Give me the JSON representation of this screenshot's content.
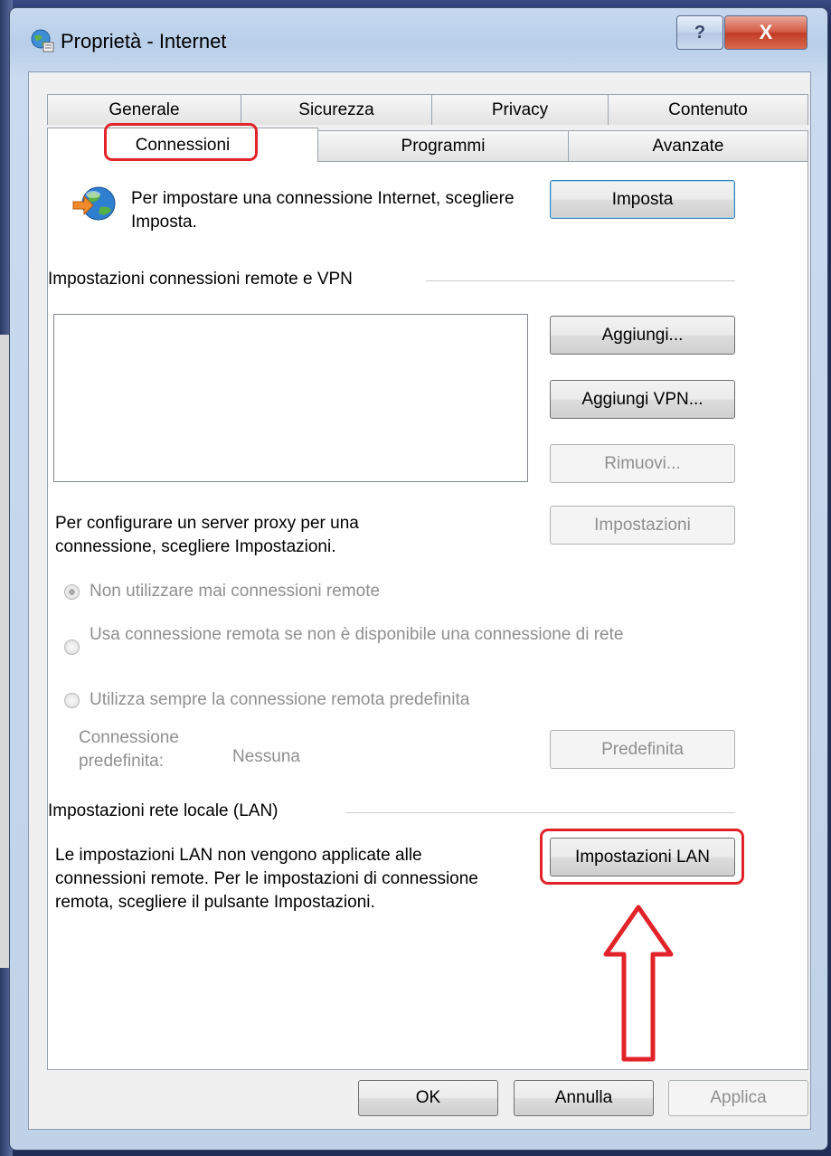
{
  "window": {
    "title": "Proprietà - Internet",
    "help_label": "?",
    "close_label": "X"
  },
  "tabs": {
    "back_row": [
      "Generale",
      "Sicurezza",
      "Privacy",
      "Contenuto"
    ],
    "front_row": [
      "Connessioni",
      "Programmi",
      "Avanzate"
    ],
    "active": "Connessioni"
  },
  "setup": {
    "text": "Per impostare una connessione Internet, scegliere Imposta.",
    "button": "Imposta"
  },
  "remote": {
    "group_label": "Impostazioni connessioni remote e VPN",
    "add_button": "Aggiungi...",
    "add_vpn_button": "Aggiungi VPN...",
    "remove_button": "Rimuovi...",
    "proxy_text": "Per configurare un server proxy per una connessione, scegliere Impostazioni.",
    "settings_button": "Impostazioni",
    "options": [
      "Non utilizzare mai connessioni remote",
      "Usa connessione remota se non è disponibile una connessione di rete",
      "Utilizza sempre la connessione remota predefinita"
    ],
    "selected_option": 0,
    "default_label": "Connessione predefinita:",
    "default_value": "Nessuna",
    "default_button": "Predefinita"
  },
  "lan": {
    "group_label": "Impostazioni rete locale (LAN)",
    "text": "Le impostazioni LAN non vengono applicate alle connessioni remote. Per le impostazioni di connessione remota, scegliere il pulsante Impostazioni.",
    "button": "Impostazioni LAN"
  },
  "footer": {
    "ok": "OK",
    "cancel": "Annulla",
    "apply": "Applica"
  },
  "colors": {
    "annotation": "#e2232a",
    "title_bar": "#c5d8ee"
  }
}
